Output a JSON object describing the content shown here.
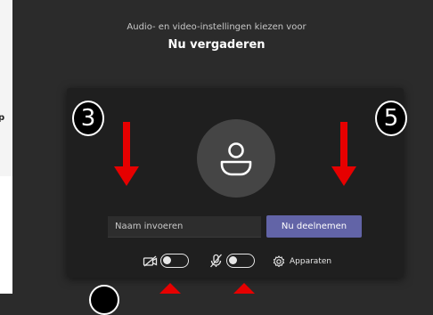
{
  "sidebar": {
    "fragment_text": "p"
  },
  "header": {
    "subtitle": "Audio- en video-instellingen kiezen voor",
    "title": "Nu vergaderen"
  },
  "prejoin": {
    "name_input": {
      "placeholder": "Naam invoeren",
      "value": ""
    },
    "join_button": "Nu deelnemen",
    "video_toggle": {
      "icon": "camera-off-icon",
      "state": "off"
    },
    "mic_toggle": {
      "icon": "microphone-off-icon",
      "state": "off"
    },
    "devices": {
      "icon": "gear-icon",
      "label": "Apparaten"
    }
  },
  "annotations": {
    "badge_left": "3",
    "badge_right": "5",
    "arrow_color": "#e60000"
  },
  "colors": {
    "background": "#2b2b2b",
    "card": "#1f1f1f",
    "accent": "#6264a7"
  }
}
